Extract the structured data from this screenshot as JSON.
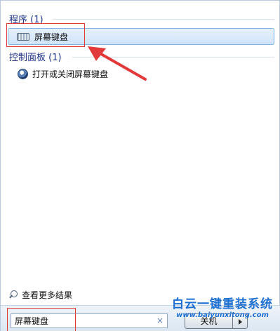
{
  "programs": {
    "title": "程序 (1)",
    "items": [
      {
        "label": "屏幕键盘",
        "icon": "keyboard-icon"
      }
    ]
  },
  "control_panel": {
    "title": "控制面板 (1)",
    "items": [
      {
        "label": "打开或关闭屏幕键盘",
        "icon": "accessibility-icon"
      }
    ]
  },
  "more_results": {
    "label": "查看更多结果",
    "icon": "search-icon"
  },
  "search": {
    "value": "屏幕键盘",
    "clear": "×"
  },
  "shutdown": {
    "label": "关机"
  },
  "watermark": {
    "title": "白云一键重装系统",
    "url": "www.baiyunxitong.com"
  },
  "colors": {
    "section_title": "#1e3287",
    "highlight": "#cfe4f9",
    "annotation": "#e23a3a",
    "watermark": "#1d6fd1"
  }
}
